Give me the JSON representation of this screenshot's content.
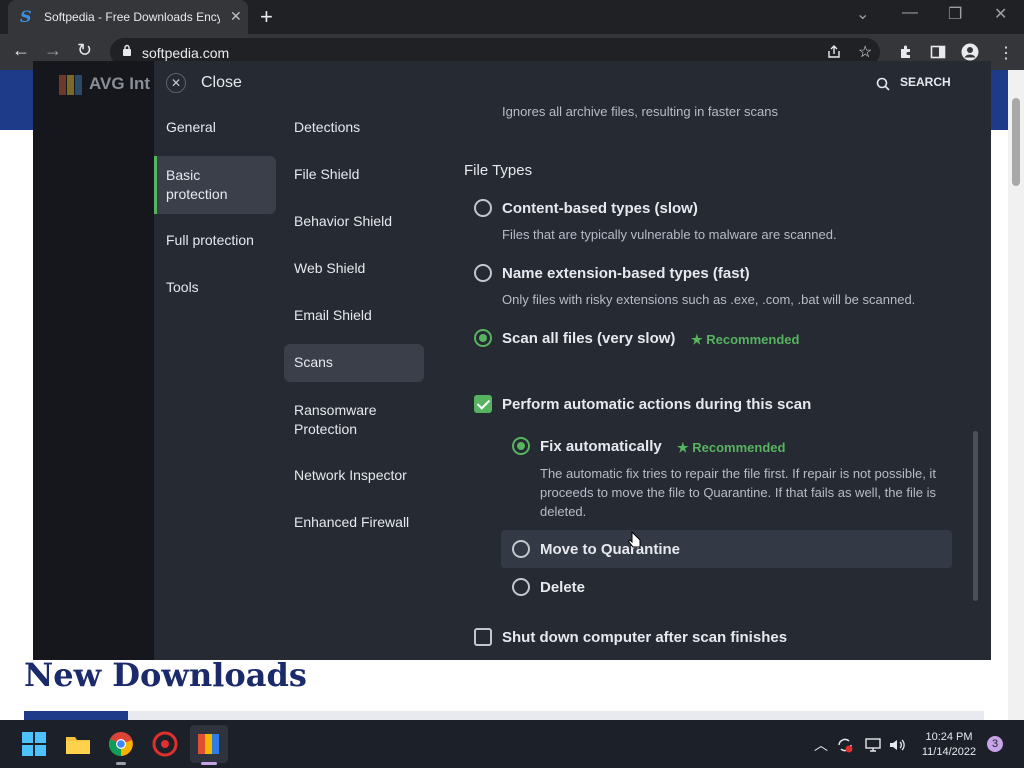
{
  "browser": {
    "tab_title": "Softpedia - Free Downloads Ency",
    "url": "softpedia.com",
    "close_glyph": "✕",
    "newtab_glyph": "+",
    "min_glyph": "—",
    "max_glyph": "❐",
    "winclose_glyph": "✕",
    "dropdown_glyph": "⌄",
    "back_glyph": "←",
    "forward_glyph": "→",
    "reload_glyph": "↻"
  },
  "page": {
    "heading": "New Downloads"
  },
  "avg": {
    "app_name": "AVG Int",
    "close_label": "Close",
    "search_label": "SEARCH",
    "categories": [
      "General",
      "Basic\nprotection",
      "Full protection",
      "Tools"
    ],
    "subs": [
      "Detections",
      "File Shield",
      "Behavior Shield",
      "Web Shield",
      "Email Shield",
      "Scans",
      "Ransomware\nProtection",
      "Network Inspector",
      "Enhanced Firewall"
    ],
    "archive_desc": "Ignores all archive files, resulting in faster scans",
    "file_types_heading": "File Types",
    "opt_content": "Content-based types (slow)",
    "opt_content_desc": "Files that are typically vulnerable to malware are scanned.",
    "opt_ext": "Name extension-based types (fast)",
    "opt_ext_desc": "Only files with risky extensions such as .exe, .com, .bat will be scanned.",
    "opt_all": "Scan all files (very slow)",
    "recommended": "★ Recommended",
    "auto_actions": "Perform automatic actions during this scan",
    "fix_auto": "Fix automatically",
    "fix_desc": "The automatic fix tries to repair the file first. If repair is not possible, it proceeds to move the file to Quarantine. If that fails as well, the file is deleted.",
    "move_quarantine": "Move to Quarantine",
    "delete": "Delete",
    "shutdown": "Shut down computer after scan finishes"
  },
  "taskbar": {
    "time": "10:24 PM",
    "date": "11/14/2022",
    "notifications": "3"
  }
}
